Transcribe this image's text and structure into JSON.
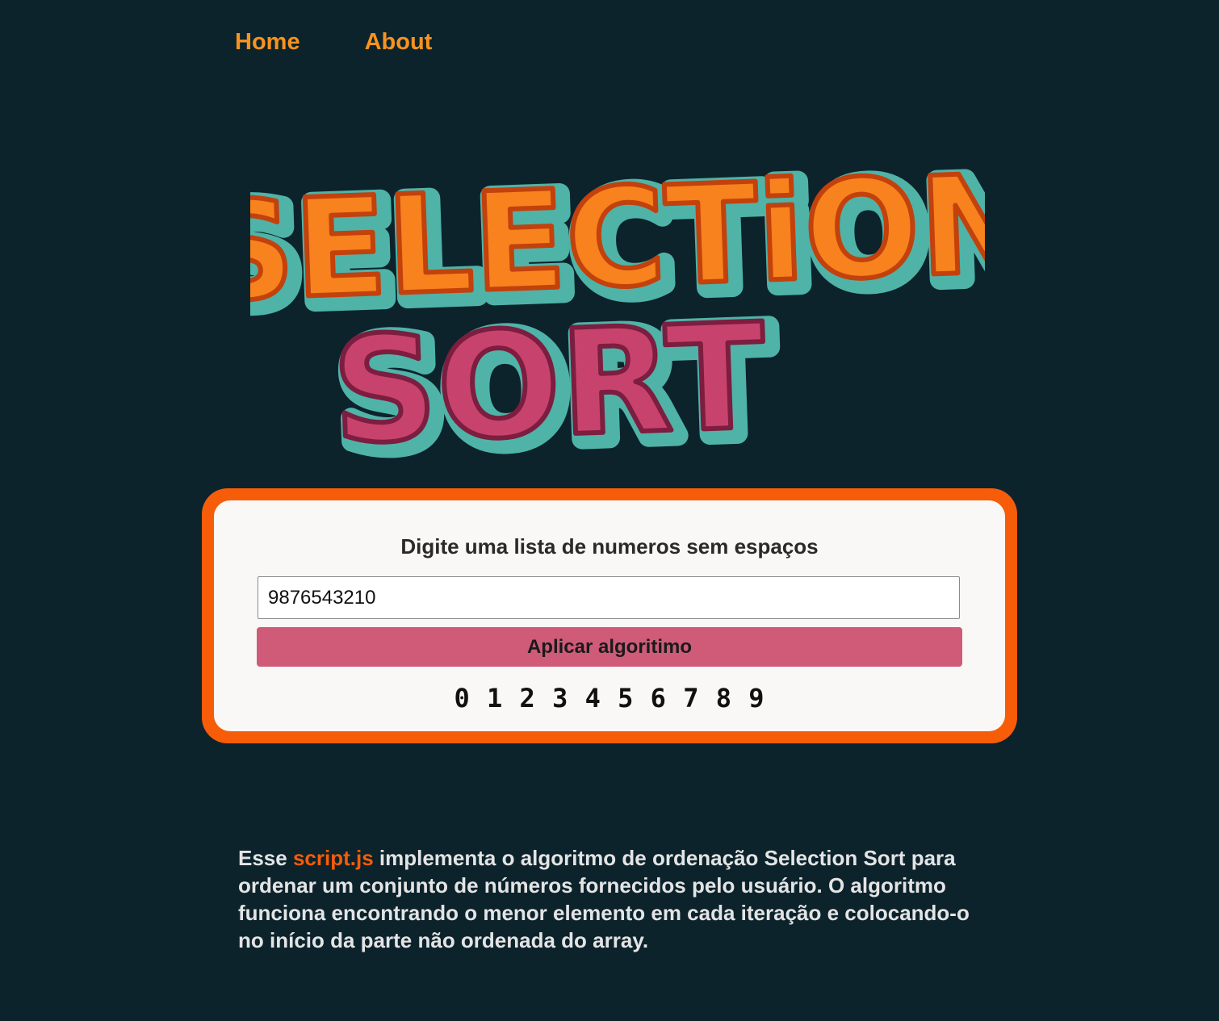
{
  "nav": {
    "items": [
      {
        "label": "Home"
      },
      {
        "label": "About"
      }
    ]
  },
  "logo": {
    "line1": "SELECTiON",
    "line2": "SORT",
    "colors": {
      "line1": "#f7821e",
      "line2": "#c7436e",
      "outline": "#4fb3a8"
    }
  },
  "form": {
    "title": "Digite uma lista de numeros sem espaços",
    "input_value": "9876543210",
    "button_label": "Aplicar algoritimo",
    "result": "0 1 2 3 4 5 6 7 8 9"
  },
  "description": {
    "prefix": "Esse ",
    "highlight": "script.js",
    "suffix": " implementa o algoritmo de ordenação Selection Sort para ordenar um conjunto de números fornecidos pelo usuário. O algoritmo funciona encontrando o menor elemento em cada iteração e colocando-o no início da parte não ordenada do array."
  },
  "colors": {
    "background": "#0c232c",
    "accent_orange": "#f75c09",
    "nav_link": "#f7931e",
    "button": "#cf5b79"
  }
}
